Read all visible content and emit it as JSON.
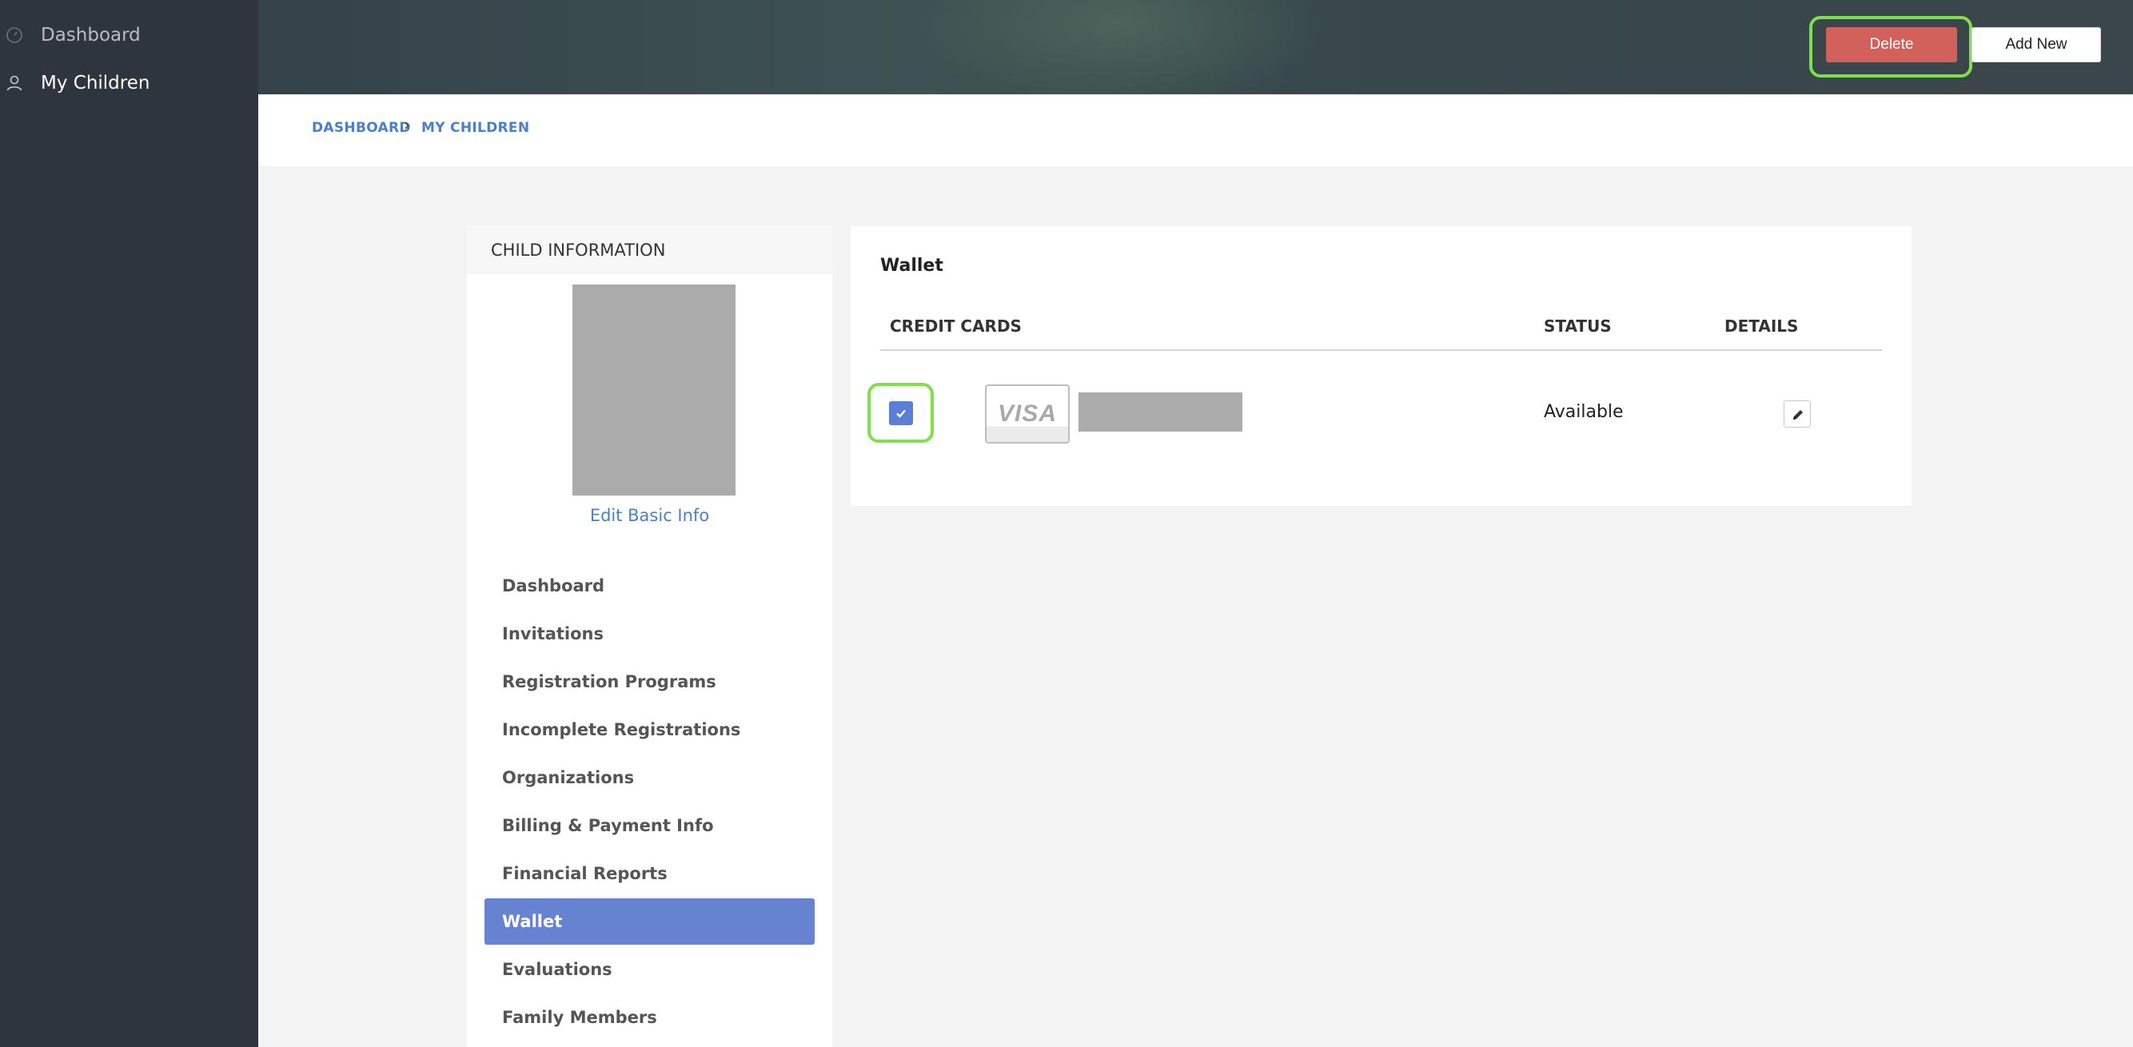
{
  "app_nav": {
    "items": [
      {
        "label": "Dashboard",
        "icon": "gauge-icon"
      },
      {
        "label": "My Children",
        "icon": "user-icon"
      }
    ]
  },
  "toolbar": {
    "delete_label": "Delete",
    "add_new_label": "Add New"
  },
  "breadcrumb": {
    "items": [
      "DASHBOARD",
      "MY CHILDREN"
    ],
    "separator": "›"
  },
  "child_panel": {
    "title": "CHILD INFORMATION",
    "edit_link": "Edit Basic Info",
    "menu": [
      "Dashboard",
      "Invitations",
      "Registration Programs",
      "Incomplete Registrations",
      "Organizations",
      "Billing & Payment Info",
      "Financial Reports",
      "Wallet",
      "Evaluations",
      "Family Members"
    ],
    "active_item": "Wallet"
  },
  "wallet": {
    "title": "Wallet",
    "columns": [
      "CREDIT CARDS",
      "STATUS",
      "DETAILS"
    ],
    "rows": [
      {
        "card_brand": "VISA",
        "status": "Available",
        "selected": true
      }
    ]
  },
  "colors": {
    "accent": "#6583d1",
    "link": "#4a7fd0",
    "danger": "#d2605b",
    "highlight": "#7ee04a",
    "sidebar_bg": "#2f353e"
  }
}
